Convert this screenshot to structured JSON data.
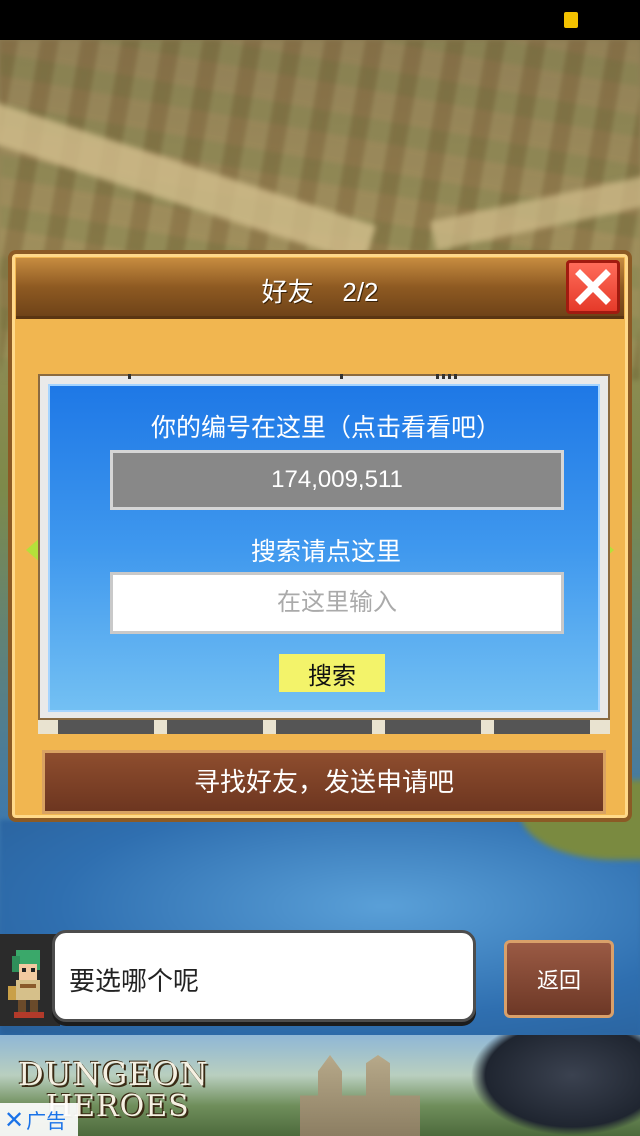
{
  "dialog": {
    "title": "好友    2/2",
    "your_id_label": "你的编号在这里（点击看看吧）",
    "your_id_value": "174,009,511",
    "search_label": "搜索请点这里",
    "search_placeholder": "在这里输入",
    "search_button": "搜索",
    "find_friends_text": "寻找好友，发送申请吧"
  },
  "speech": {
    "text": "要选哪个呢"
  },
  "back_button": "返回",
  "ad": {
    "logo_line1": "DUNGEON",
    "logo_line2": "HEROES",
    "close_label": "广告"
  },
  "colors": {
    "panel_blue": "#1e78e6",
    "dialog_gold": "#f1b650",
    "close_red": "#e53a2a",
    "search_yellow": "#f3f36a",
    "arrow_green": "#b5e03a"
  }
}
